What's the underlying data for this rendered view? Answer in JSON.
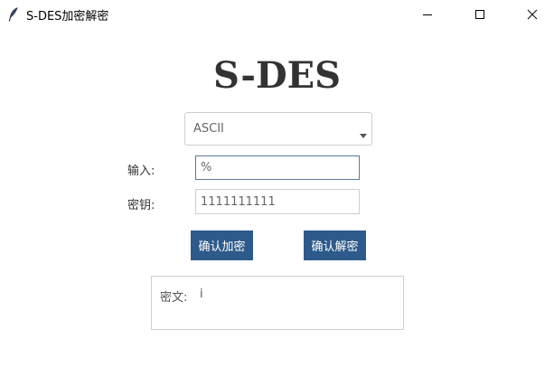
{
  "window": {
    "title": "S-DES加密解密",
    "icon": "feather-icon"
  },
  "heading": "S-DES",
  "mode_select": {
    "selected": "ASCII"
  },
  "form": {
    "input_label": "输入:",
    "input_value": "%",
    "key_label": "密钥:",
    "key_value": "1111111111"
  },
  "buttons": {
    "encrypt_label": "确认加密",
    "decrypt_label": "确认解密"
  },
  "output": {
    "label": "密文:",
    "value": "i"
  },
  "colors": {
    "button_bg": "#2d5a8a",
    "button_text": "#ffffff",
    "focused_border": "#5a7a9a"
  }
}
